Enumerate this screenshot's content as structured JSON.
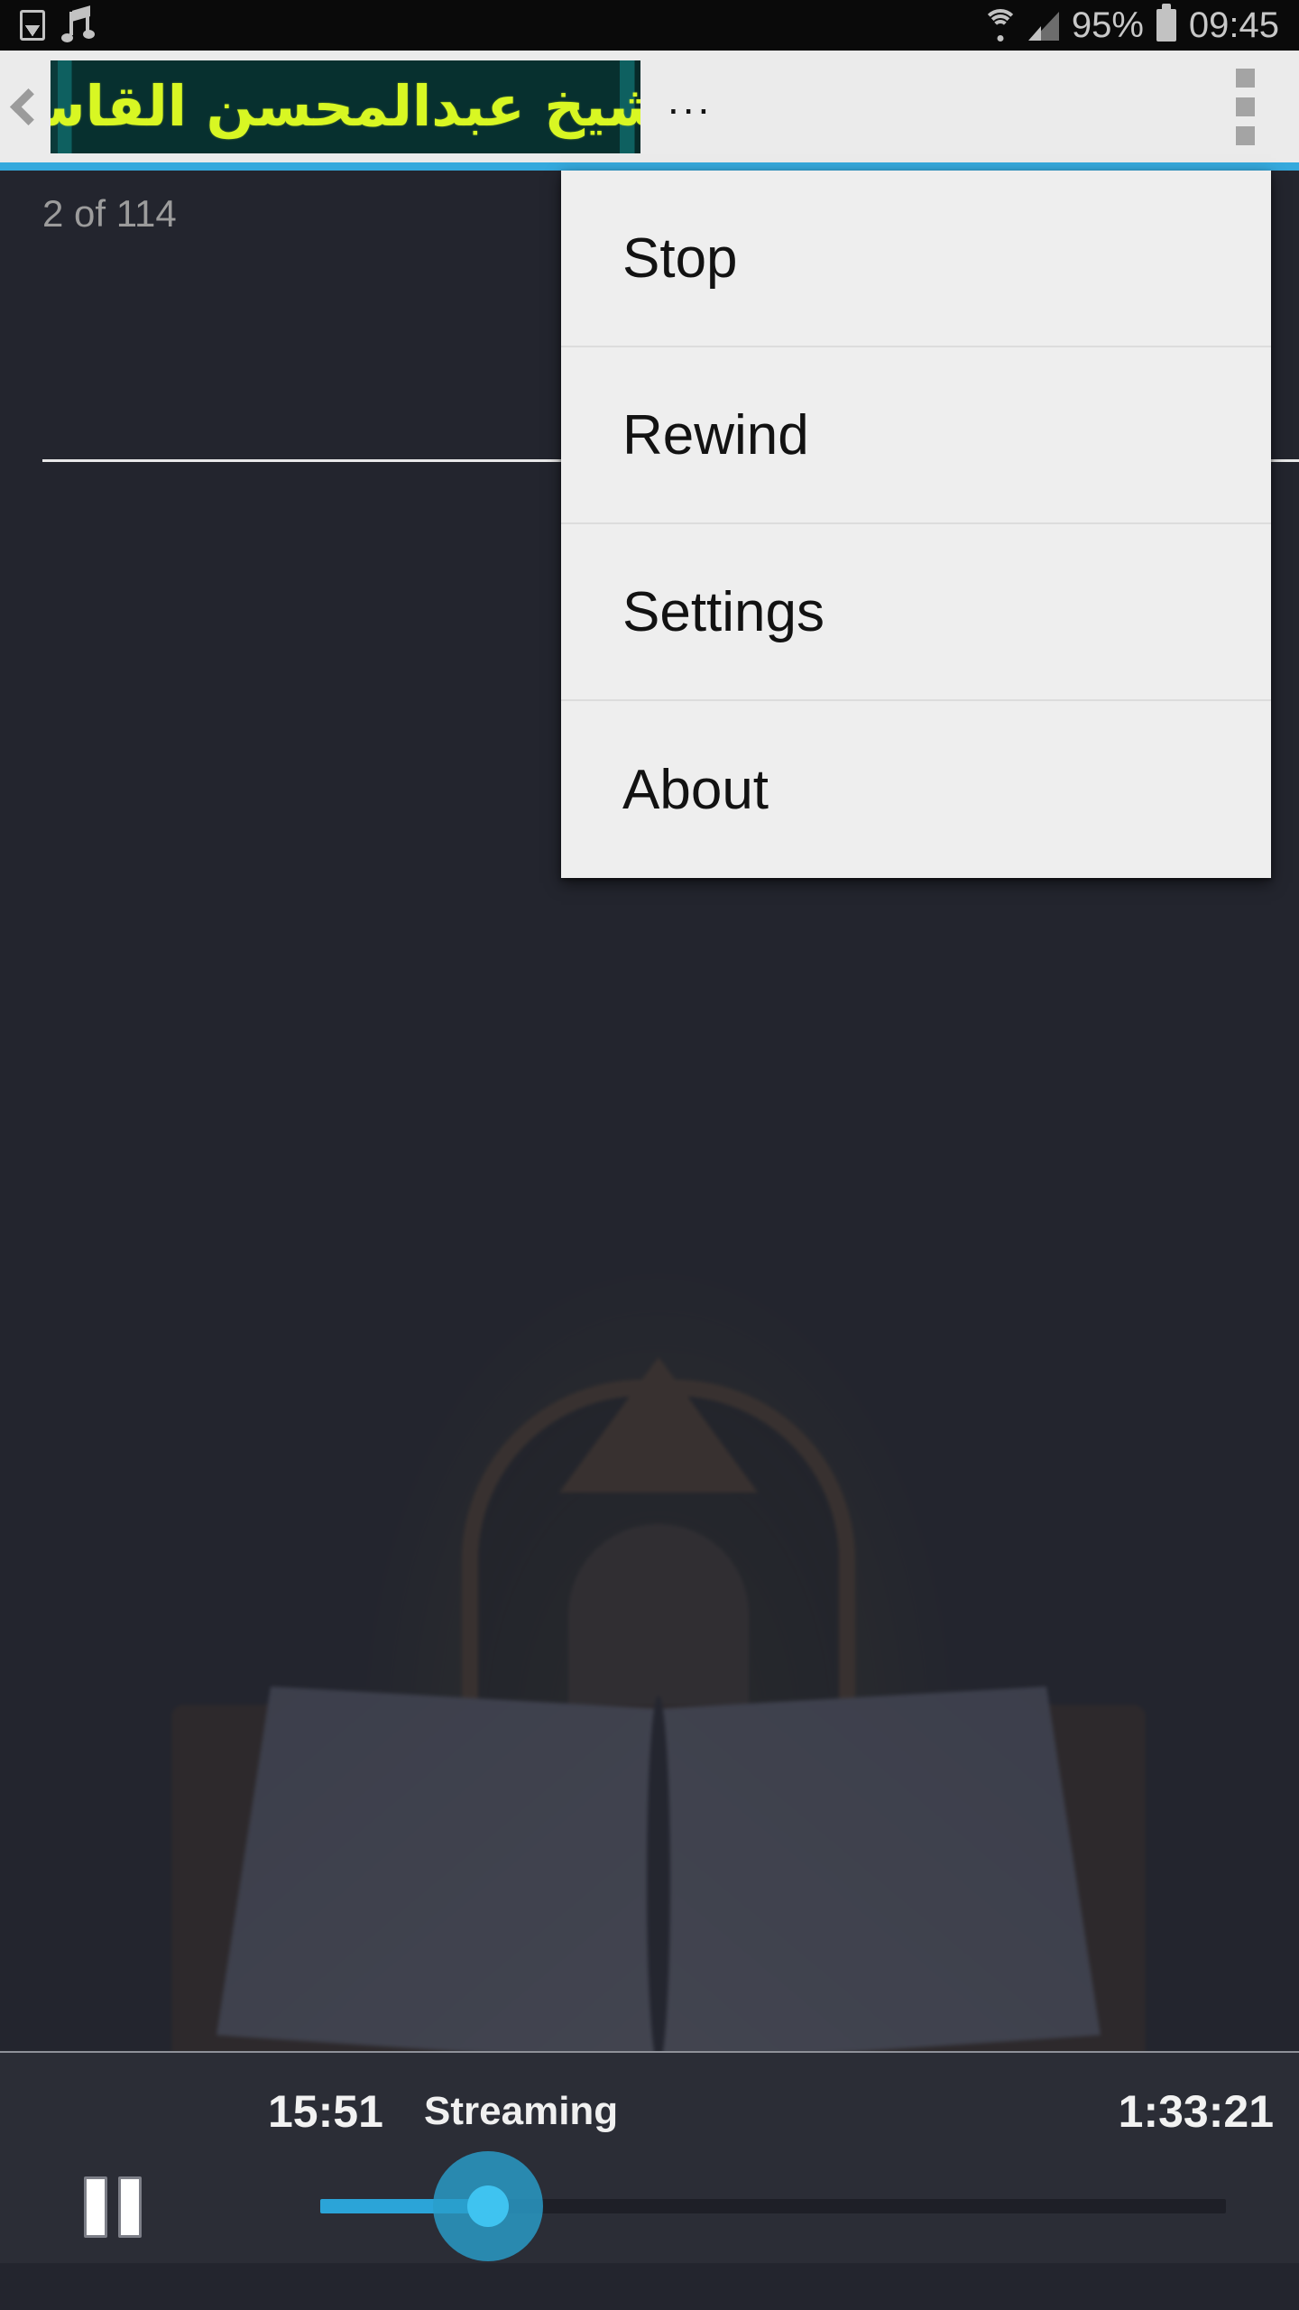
{
  "status_bar": {
    "icons_left": [
      "gallery-icon",
      "music-note-icon"
    ],
    "wifi_icon": "wifi-icon",
    "signal_icon": "cellular-signal-icon",
    "battery_percent": "95%",
    "battery_icon": "battery-icon",
    "clock": "09:45"
  },
  "app_bar": {
    "back_icon": "back-chevron-icon",
    "title": "الشيخ عبدالمحسن القاسم",
    "inline_overflow": "...",
    "kebab_icon": "kebab-menu-icon"
  },
  "content": {
    "page_counter": "2 of 114"
  },
  "overflow_menu": {
    "items": [
      {
        "label": "Stop"
      },
      {
        "label": "Rewind"
      },
      {
        "label": "Settings"
      },
      {
        "label": "About"
      }
    ]
  },
  "player": {
    "elapsed": "15:51",
    "status": "Streaming",
    "total": "1:33:21",
    "pause_icon": "pause-icon",
    "progress_percent": 18.5
  },
  "colors": {
    "accent_blue": "#35a9dd",
    "seek_blue": "#2ba4d8",
    "thumb_blue": "#3fc3f0",
    "banner_green": "#07302f",
    "title_yellow": "#d8f723",
    "content_dark": "#23252e",
    "menu_bg": "#eeeeee",
    "app_bar_bg": "#ebebeb"
  }
}
